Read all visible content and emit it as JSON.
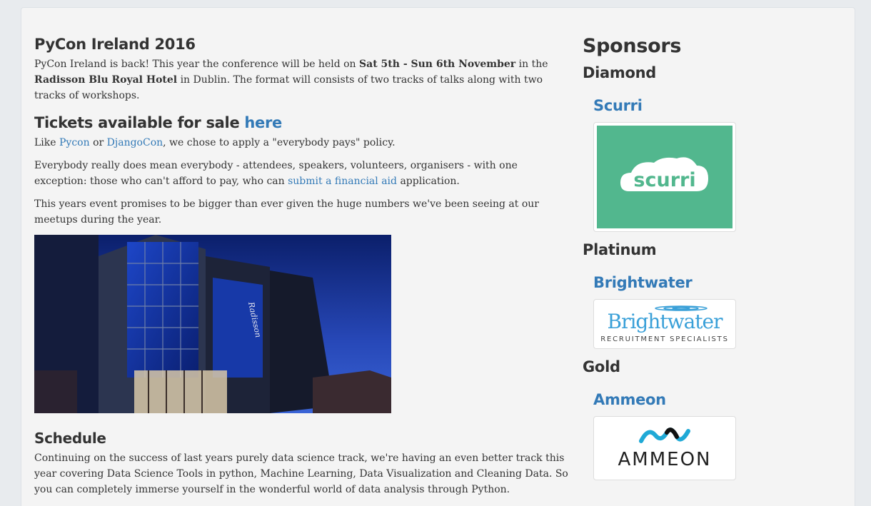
{
  "intro": {
    "title": "PyCon Ireland 2016",
    "p_before": "PyCon Ireland is back! This year the conference will be held on ",
    "dates": "Sat 5th - Sun 6th November",
    "p_mid": " in the ",
    "venue": "Radisson Blu Royal Hotel",
    "p_after": " in Dublin. The format will consists of two tracks of talks along with two tracks of workshops."
  },
  "tickets": {
    "heading": "Tickets available for sale ",
    "link": "here",
    "like": "Like ",
    "pycon": "Pycon",
    "or": " or ",
    "djangocon": "DjangoCon",
    "policy": ", we chose to apply a \"everybody pays\" policy.",
    "everybody_before": "Everybody really does mean everybody - attendees, speakers, volunteers, organisers - with one exception: those who can't afford to pay, who can ",
    "financial_link": "submit a financial aid",
    "everybody_after": " application.",
    "bigger": "This years event promises to be bigger than ever given the huge numbers we've been seeing at our meetups during the year."
  },
  "hotel_image": {
    "sign_text": "Radisson"
  },
  "schedule": {
    "heading": "Schedule",
    "text": "Continuing on the success of last years purely data science track, we're having an even better track this year covering Data Science Tools in python, Machine Learning, Data Visualization and Cleaning Data. So you can completely immerse yourself in the wonderful world of data analysis through Python."
  },
  "sponsors": {
    "title": "Sponsors",
    "tiers": [
      {
        "label": "Diamond",
        "sponsor": "Scurri",
        "logo_text": "scurri",
        "logo_color": "#52b78e"
      },
      {
        "label": "Platinum",
        "sponsor": "Brightwater",
        "logo_text": "Brightwater",
        "logo_sub": "RECRUITMENT SPECIALISTS",
        "logo_color": "#3aa0d8"
      },
      {
        "label": "Gold",
        "sponsor": "Ammeon",
        "logo_text": "AMMEON",
        "logo_color": "#1fa9d6"
      }
    ]
  }
}
